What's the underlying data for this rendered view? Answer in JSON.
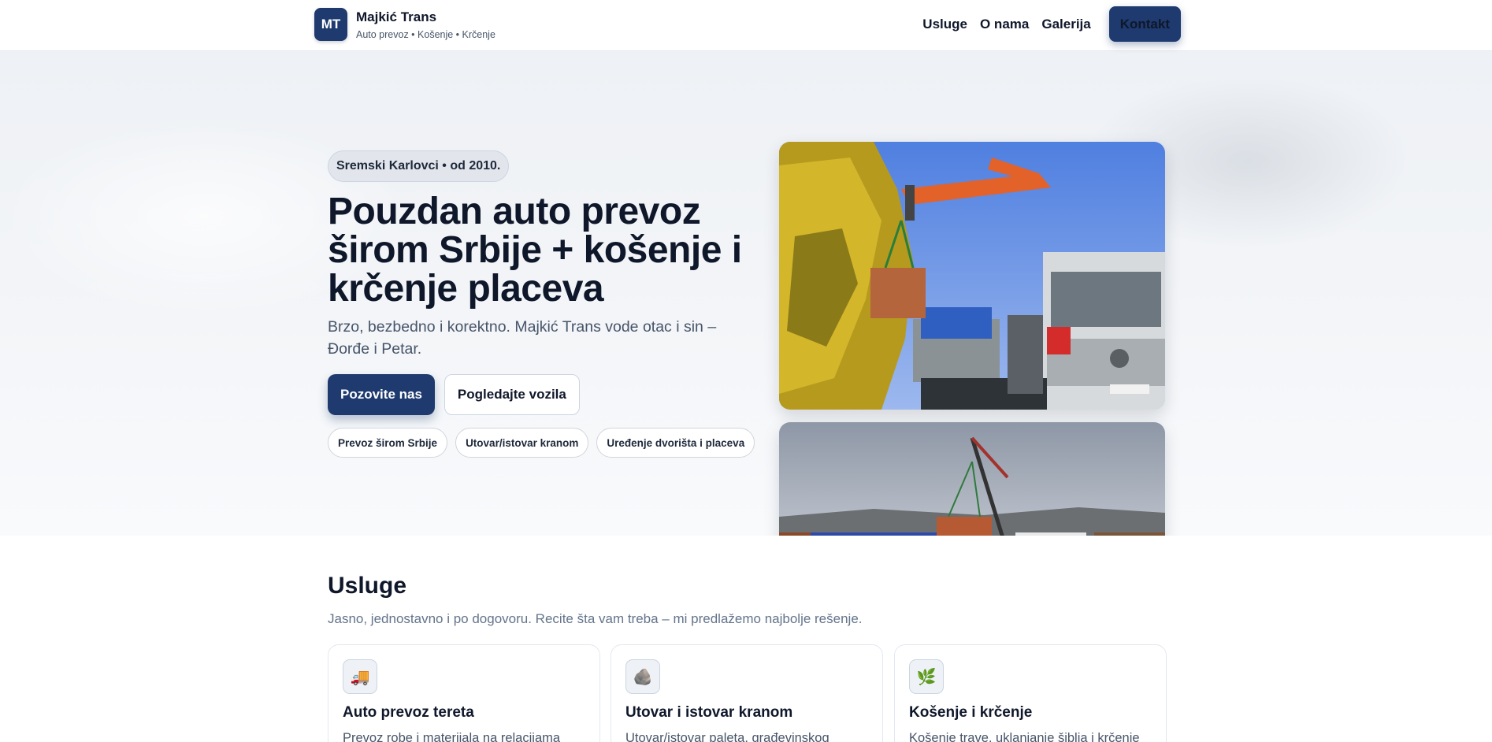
{
  "header": {
    "logo_initials": "MT",
    "brand_name": "Majkić Trans",
    "brand_tagline": "Auto prevoz • Košenje • Krčenje",
    "nav": [
      {
        "label": "Usluge"
      },
      {
        "label": "O nama"
      },
      {
        "label": "Galerija"
      }
    ],
    "cta_label": "Kontakt"
  },
  "hero": {
    "badge": "Sremski Karlovci • od 2010.",
    "title": "Pouzdan auto prevoz širom Srbije + košenje i krčenje placeva",
    "subtitle": "Brzo, bezbedno i korektno. Majkić Trans vode otac i sin – Đorđe i Petar.",
    "primary_button": "Pozovite nas",
    "secondary_button": "Pogledajte vozila",
    "chips": [
      {
        "label": "Prevoz širom Srbije"
      },
      {
        "label": "Utovar/istovar kranom"
      },
      {
        "label": "Uređenje dvorišta i placeva"
      }
    ]
  },
  "services": {
    "title": "Usluge",
    "subtitle": "Jasno, jednostavno i po dogovoru. Recite šta vam treba – mi predlažemo najbolje rešenje.",
    "cards": [
      {
        "icon": "🚚",
        "icon_name": "truck-icon",
        "title": "Auto prevoz tereta",
        "text": "Prevoz robe i materijala na relacijama"
      },
      {
        "icon": "🪨",
        "icon_name": "rock-icon",
        "title": "Utovar i istovar kranom",
        "text": "Utovar/istovar paleta, građevinskog"
      },
      {
        "icon": "🌿",
        "icon_name": "herb-icon",
        "title": "Košenje i krčenje",
        "text": "Košenje trave, uklanjanje šiblja i krčenje"
      }
    ]
  },
  "colors": {
    "brand_navy": "#1e3a6e",
    "text_dark": "#0f172a",
    "text_muted": "#475569"
  }
}
